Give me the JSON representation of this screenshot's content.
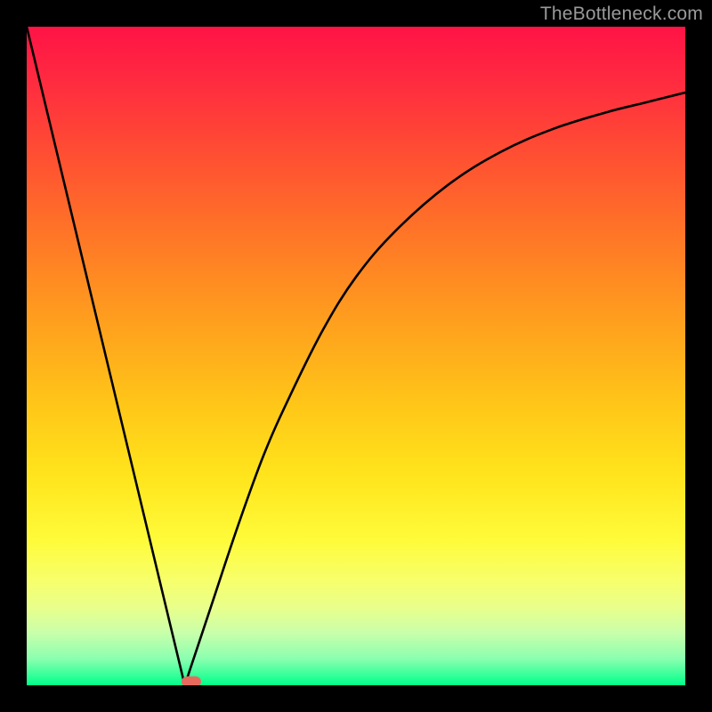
{
  "attribution": "TheBottleneck.com",
  "chart_data": {
    "type": "line",
    "title": "",
    "xlabel": "",
    "ylabel": "",
    "xlim": [
      0,
      100
    ],
    "ylim": [
      0,
      100
    ],
    "grid": false,
    "series": [
      {
        "name": "left-line",
        "x": [
          0,
          24
        ],
        "y": [
          100,
          0
        ]
      },
      {
        "name": "right-curve",
        "x": [
          24,
          28,
          32,
          36,
          40,
          45,
          50,
          56,
          64,
          72,
          80,
          88,
          94,
          100
        ],
        "y": [
          0,
          12,
          24,
          35,
          44,
          54,
          62,
          69,
          76,
          81,
          84.5,
          87,
          88.5,
          90
        ]
      }
    ],
    "marker": {
      "x": 25,
      "y": 0.5,
      "color": "#e86a5e",
      "shape": "pill"
    },
    "background": {
      "type": "vertical-gradient",
      "stops": [
        {
          "pos": 0,
          "color": "#ff1346"
        },
        {
          "pos": 50,
          "color": "#ffc818"
        },
        {
          "pos": 80,
          "color": "#fffb3a"
        },
        {
          "pos": 100,
          "color": "#00ff8a"
        }
      ]
    }
  }
}
